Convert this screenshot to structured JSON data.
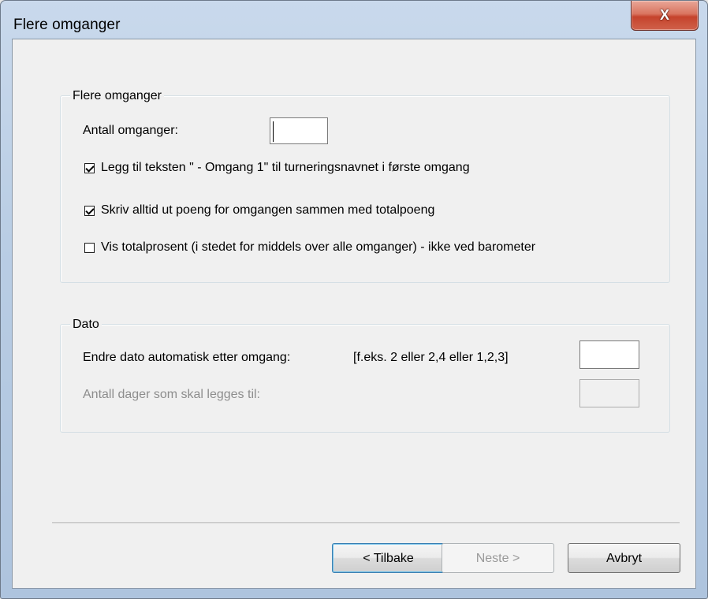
{
  "window": {
    "title": "Flere omganger",
    "close_glyph": "X"
  },
  "group_rounds": {
    "legend": "Flere omganger",
    "rounds_label": "Antall omganger:",
    "rounds_value": "",
    "checkboxes": [
      {
        "label": "Legg til teksten \" - Omgang 1\" til turneringsnavnet i første omgang",
        "checked": true
      },
      {
        "label": "Skriv alltid ut poeng for omgangen sammen med totalpoeng",
        "checked": true
      },
      {
        "label": "Vis totalprosent (i stedet for middels over alle omganger) - ikke ved barometer",
        "checked": false
      }
    ]
  },
  "group_date": {
    "legend": "Dato",
    "change_date_label": "Endre dato automatisk etter omgang:",
    "change_date_hint": "[f.eks. 2 eller 2,4 eller 1,2,3]",
    "change_date_value": "",
    "days_label": "Antall dager som skal legges til:",
    "days_value": ""
  },
  "buttons": {
    "back": "< Tilbake",
    "next": "Neste >",
    "cancel": "Avbryt"
  },
  "colors": {
    "frame": "#b9cde4",
    "close_button": "#c5432c",
    "default_button_border": "#3c7fb1"
  }
}
